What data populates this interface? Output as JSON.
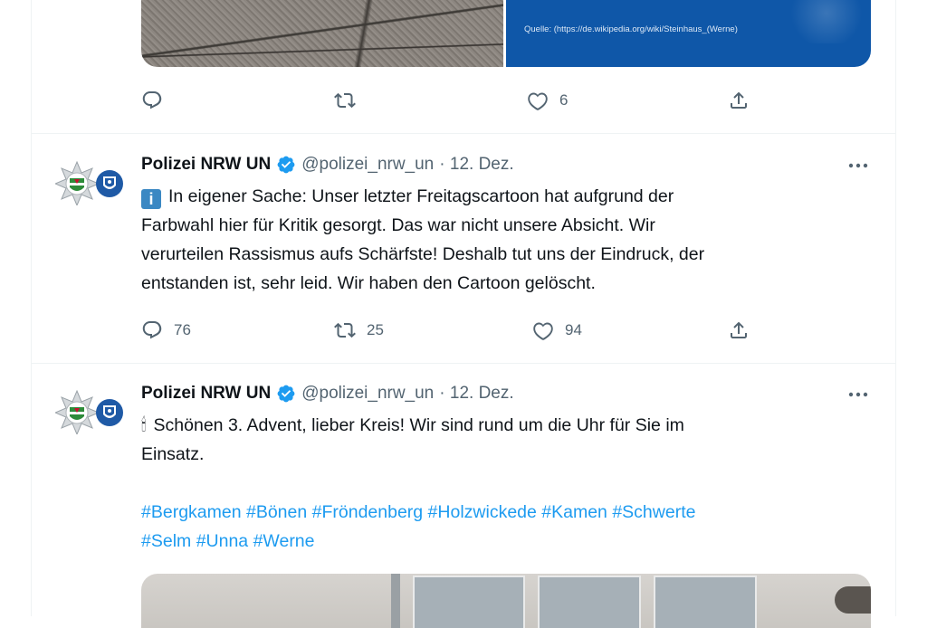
{
  "top_tweet": {
    "media_caption": "Quelle: (https://de.wikipedia.org/wiki/Steinhaus_(Werne)",
    "actions": {
      "reply_count": "",
      "retweet_count": "",
      "like_count": "6"
    }
  },
  "tweets": [
    {
      "author": "Polizei NRW UN",
      "handle": "@polizei_nrw_un",
      "date": "· 12. Dez.",
      "info_glyph": "i",
      "lines": [
        "In eigener Sache: Unser letzter Freitagscartoon hat aufgrund der",
        "Farbwahl hier für Kritik gesorgt. Das war nicht unsere Absicht. Wir",
        "verurteilen Rassismus aufs Schärfste! Deshalb tut uns der Eindruck, der",
        "entstanden ist, sehr leid. Wir haben den Cartoon gelöscht."
      ],
      "reply_count": "76",
      "retweet_count": "25",
      "like_count": "94"
    },
    {
      "author": "Polizei NRW UN",
      "handle": "@polizei_nrw_un",
      "date": "· 12. Dez.",
      "candle_glyph": "🕯",
      "lines": [
        "Schönen 3. Advent, lieber Kreis! Wir sind rund um die Uhr für Sie im",
        "Einsatz."
      ],
      "hashtag_lines": [
        "#Bergkamen #Bönen #Fröndenberg #Holzwickede #Kamen #Schwerte",
        "#Selm #Unna #Werne"
      ]
    }
  ],
  "icons": {
    "reply": "reply-icon",
    "retweet": "retweet-icon",
    "like": "heart-icon",
    "share": "share-icon",
    "verified": "verified-badge-icon",
    "more": "more-options-icon"
  },
  "colors": {
    "text": "#0f1419",
    "secondary": "#536471",
    "link": "#1d9bf0",
    "verified": "#1d9bf0",
    "border": "#eff3f4"
  }
}
